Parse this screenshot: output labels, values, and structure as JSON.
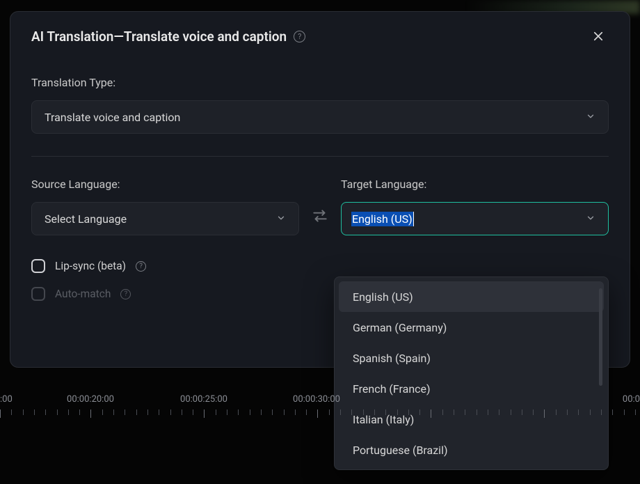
{
  "dialog": {
    "title": "AI Translation—Translate voice and caption"
  },
  "translation_type": {
    "label": "Translation Type:",
    "selected": "Translate voice and caption"
  },
  "source_language": {
    "label": "Source Language:",
    "selected": "Select Language"
  },
  "target_language": {
    "label": "Target Language:",
    "input_value": "English (US)",
    "options": [
      "English (US)",
      "German (Germany)",
      "Spanish (Spain)",
      "French (France)",
      "Italian (Italy)",
      "Portuguese (Brazil)"
    ]
  },
  "lip_sync": {
    "label": "Lip-sync (beta)",
    "checked": false
  },
  "auto_match": {
    "label": "Auto-match",
    "checked": false,
    "disabled": true
  },
  "timeline": {
    "labels": [
      {
        "text": ":00",
        "pos": 0
      },
      {
        "text": "00:00:20:00",
        "pos": 130
      },
      {
        "text": "00:00:25:00",
        "pos": 293
      },
      {
        "text": "00:00:30:00",
        "pos": 455
      },
      {
        "text": "00:0",
        "pos": 905
      }
    ]
  }
}
